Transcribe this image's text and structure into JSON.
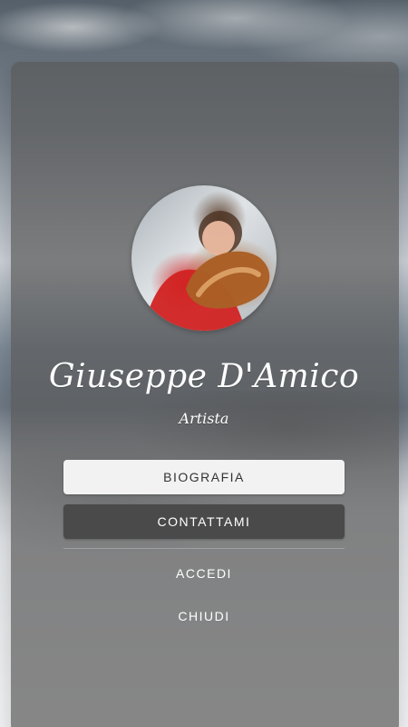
{
  "profile": {
    "name": "Giuseppe D'Amico",
    "role": "Artista"
  },
  "actions": {
    "biography": "BIOGRAFIA",
    "contact": "CONTATTAMI",
    "login": "ACCEDI",
    "close": "CHIUDI"
  },
  "colors": {
    "card_overlay": "#5a5a5a",
    "button_light": "#f2f2f2",
    "button_dark": "#4a4a4a",
    "text_light": "#ffffff",
    "text_dark": "#333333"
  }
}
